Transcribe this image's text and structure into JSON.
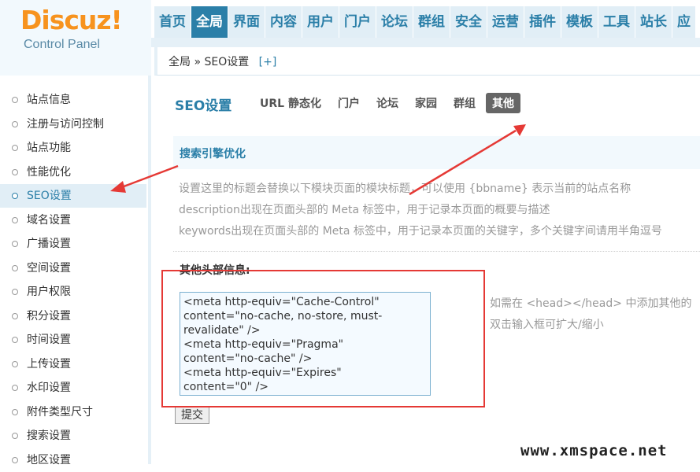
{
  "logo": {
    "main": "Discuz!",
    "sub": "Control Panel"
  },
  "nav": {
    "items": [
      "首页",
      "全局",
      "界面",
      "内容",
      "用户",
      "门户",
      "论坛",
      "群组",
      "安全",
      "运营",
      "插件",
      "模板",
      "工具",
      "站长",
      "应"
    ],
    "active_index": 1
  },
  "breadcrumb": {
    "path": "全局 » SEO设置",
    "add": "[+]"
  },
  "sidebar": {
    "items": [
      "站点信息",
      "注册与访问控制",
      "站点功能",
      "性能优化",
      "SEO设置",
      "域名设置",
      "广播设置",
      "空间设置",
      "用户权限",
      "积分设置",
      "时间设置",
      "上传设置",
      "水印设置",
      "附件类型尺寸",
      "搜索设置",
      "地区设置"
    ],
    "active_index": 4
  },
  "main": {
    "title": "SEO设置",
    "tabs": [
      "URL 静态化",
      "门户",
      "论坛",
      "家园",
      "群组",
      "其他"
    ],
    "active_tab": 5,
    "tips_title": "搜索引擎优化",
    "tips": [
      "设置这里的标题会替换以下模块页面的模块标题，可以使用 {bbname} 表示当前的站点名称",
      "description出现在页面头部的 Meta 标签中，用于记录本页面的概要与描述",
      "keywords出现在页面头部的 Meta 标签中，用于记录本页面的关键字，多个关键字间请用半角逗号"
    ],
    "field_label": "其他头部信息:",
    "field_value": "<meta http-equiv=\"Cache-Control\"\ncontent=\"no-cache, no-store, must-\nrevalidate\" />\n<meta http-equiv=\"Pragma\"\ncontent=\"no-cache\" />\n<meta http-equiv=\"Expires\"\ncontent=\"0\" />",
    "hint": [
      "如需在 <head></head> 中添加其他的",
      "双击输入框可扩大/缩小"
    ],
    "submit": "提交"
  },
  "watermark": "www.xmspace.net",
  "colors": {
    "accent": "#2b7fa8",
    "annotation": "#e53935",
    "logo": "#f7931e"
  }
}
